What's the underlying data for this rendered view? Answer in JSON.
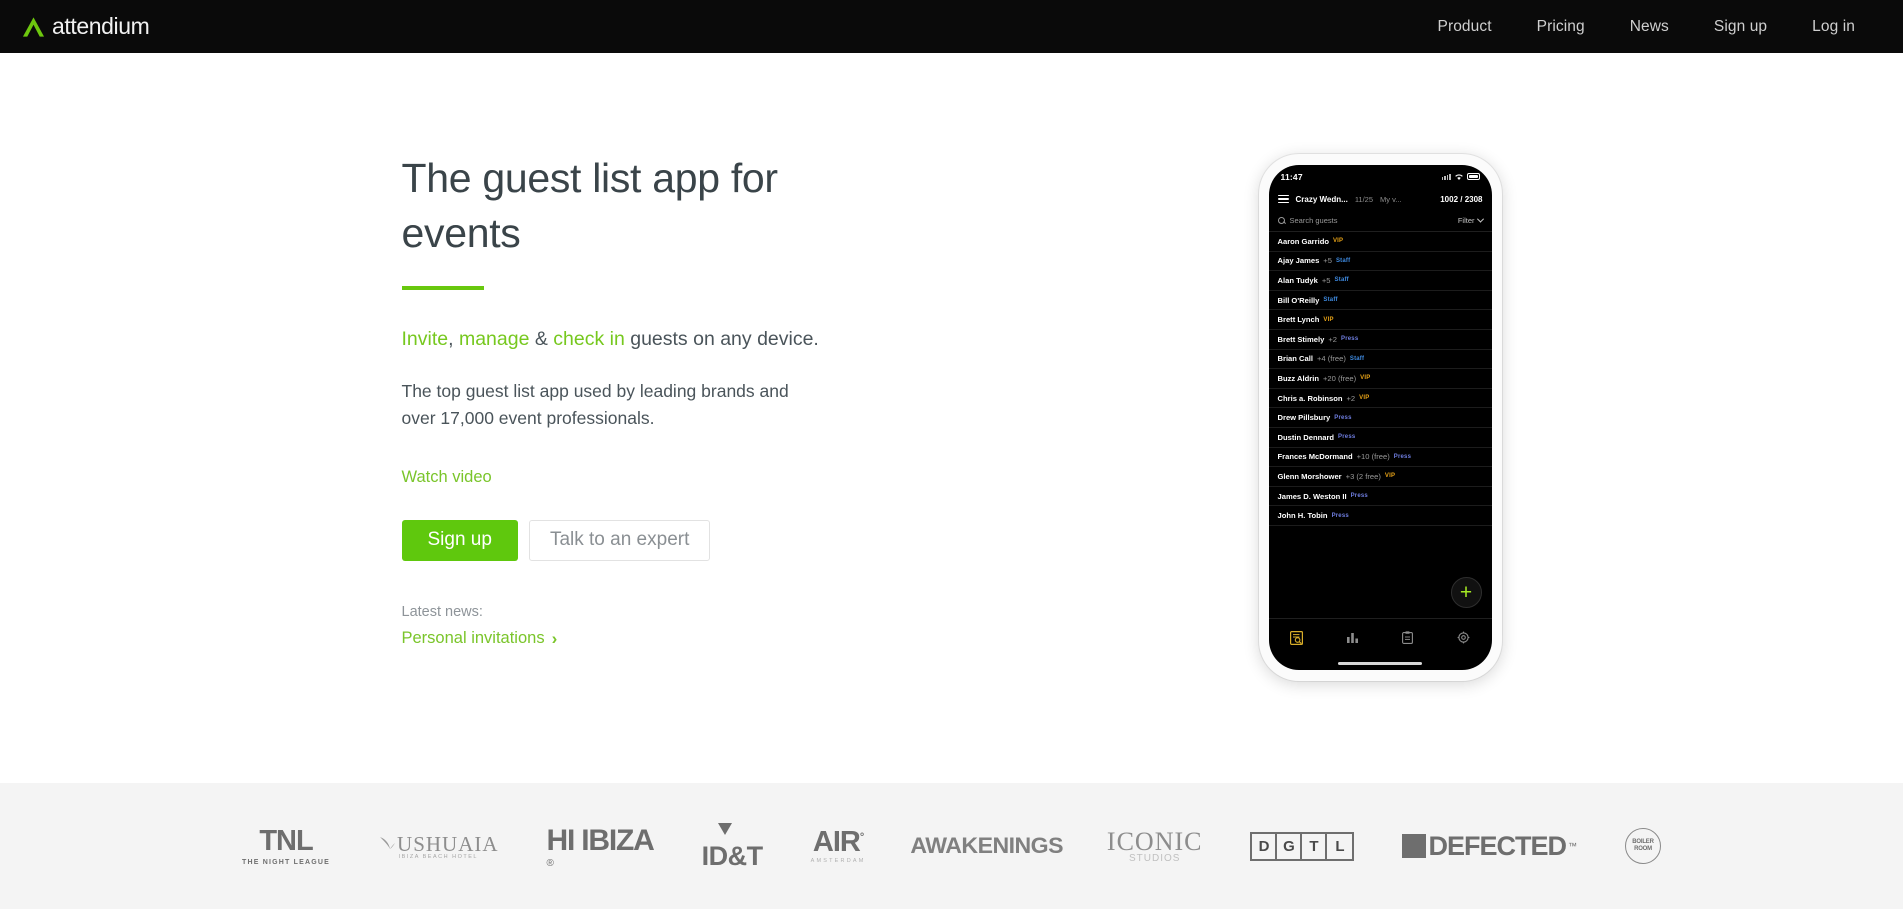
{
  "nav": {
    "logo_text": "attendium",
    "items": [
      {
        "label": "Product"
      },
      {
        "label": "Pricing"
      },
      {
        "label": "News"
      },
      {
        "label": "Sign up"
      },
      {
        "label": "Log in"
      }
    ]
  },
  "hero": {
    "headline": "The guest list app for events",
    "subline": {
      "invite": "Invite",
      "comma": ", ",
      "manage": "manage",
      "amp": " & ",
      "checkin": "check in",
      "rest": " guests on any device."
    },
    "blurb": "The top guest list app used by leading brands and over 17,000 event professionals.",
    "watch_video": "Watch video",
    "primary_button": "Sign up",
    "secondary_button": "Talk to an expert",
    "news_label": "Latest news:",
    "news_link": "Personal invitations",
    "news_chevron": "›"
  },
  "phone": {
    "status": {
      "time": "11:47"
    },
    "app_header": {
      "event_name": "Crazy Wedn...",
      "date": "11/25",
      "view": "My v...",
      "count": "1002 / 2308"
    },
    "search": {
      "placeholder": "Search guests",
      "filter_label": "Filter"
    },
    "guests": [
      {
        "name": "Aaron Garrido",
        "extra": "",
        "tag": "VIP",
        "tag_type": "vip"
      },
      {
        "name": "Ajay James",
        "extra": "+5",
        "tag": "Staff",
        "tag_type": "staff"
      },
      {
        "name": "Alan Tudyk",
        "extra": "+5",
        "tag": "Staff",
        "tag_type": "staff"
      },
      {
        "name": "Bill O'Reilly",
        "extra": "",
        "tag": "Staff",
        "tag_type": "staff"
      },
      {
        "name": "Brett Lynch",
        "extra": "",
        "tag": "VIP",
        "tag_type": "vip"
      },
      {
        "name": "Brett Stimely",
        "extra": "+2",
        "tag": "Press",
        "tag_type": "press"
      },
      {
        "name": "Brian Call",
        "extra": "+4 (free)",
        "tag": "Staff",
        "tag_type": "staff"
      },
      {
        "name": "Buzz Aldrin",
        "extra": "+20 (free)",
        "tag": "VIP",
        "tag_type": "vip"
      },
      {
        "name": "Chris a. Robinson",
        "extra": "+2",
        "tag": "VIP",
        "tag_type": "vip"
      },
      {
        "name": "Drew Pillsbury",
        "extra": "",
        "tag": "Press",
        "tag_type": "press"
      },
      {
        "name": "Dustin Dennard",
        "extra": "",
        "tag": "Press",
        "tag_type": "press"
      },
      {
        "name": "Frances McDormand",
        "extra": "+10 (free)",
        "tag": "Press",
        "tag_type": "press"
      },
      {
        "name": "Glenn Morshower",
        "extra": "+3 (2 free)",
        "tag": "VIP",
        "tag_type": "vip"
      },
      {
        "name": "James D. Weston II",
        "extra": "",
        "tag": "Press",
        "tag_type": "press"
      },
      {
        "name": "John H. Tobin",
        "extra": "",
        "tag": "Press",
        "tag_type": "press"
      }
    ],
    "fab_label": "+",
    "tabs": [
      {
        "icon": "guest-list-icon",
        "active": true
      },
      {
        "icon": "stats-bar-chart-icon",
        "active": false
      },
      {
        "icon": "clipboard-icon",
        "active": false
      },
      {
        "icon": "gear-icon",
        "active": false
      }
    ]
  },
  "brands": [
    {
      "id": "tnl",
      "name": "TNL",
      "sub": "THE NIGHT LEAGUE"
    },
    {
      "id": "ushuaia",
      "name": "USHUAIA",
      "sub": "IBIZA BEACH HOTEL"
    },
    {
      "id": "hi-ibiza",
      "name": "HI IBIZA",
      "sub": "®"
    },
    {
      "id": "idt",
      "name": "ID&T",
      "sub": ""
    },
    {
      "id": "air",
      "name": "AIR",
      "sub": "AMSTERDAM"
    },
    {
      "id": "awakenings",
      "name": "AWAKENINGS",
      "sub": ""
    },
    {
      "id": "iconic",
      "name": "ICONIC",
      "sub": "STUDIOS"
    },
    {
      "id": "dgtl",
      "name": "DGTL",
      "sub": ""
    },
    {
      "id": "defected",
      "name": "DEFECTED",
      "sub": "™"
    },
    {
      "id": "boiler-room",
      "name": "BOILER ROOM",
      "sub": ""
    }
  ],
  "colors": {
    "accent_green": "#5fc80d",
    "nav_bg": "#0a0a0a",
    "band_bg": "#f4f4f4",
    "tag_vip": "#e8a317",
    "tag_staff": "#3e8ae0",
    "tag_press": "#6f7ee0"
  }
}
